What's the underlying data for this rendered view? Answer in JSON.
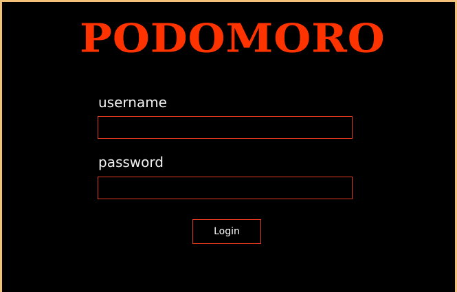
{
  "app": {
    "logo_text": "PODOMORO",
    "accent_color": "#ff3300",
    "border_color": "#e23a1e",
    "background_color": "#000000"
  },
  "form": {
    "username_label": "username",
    "username_value": "",
    "password_label": "password",
    "password_value": "",
    "login_button_label": "Login"
  }
}
